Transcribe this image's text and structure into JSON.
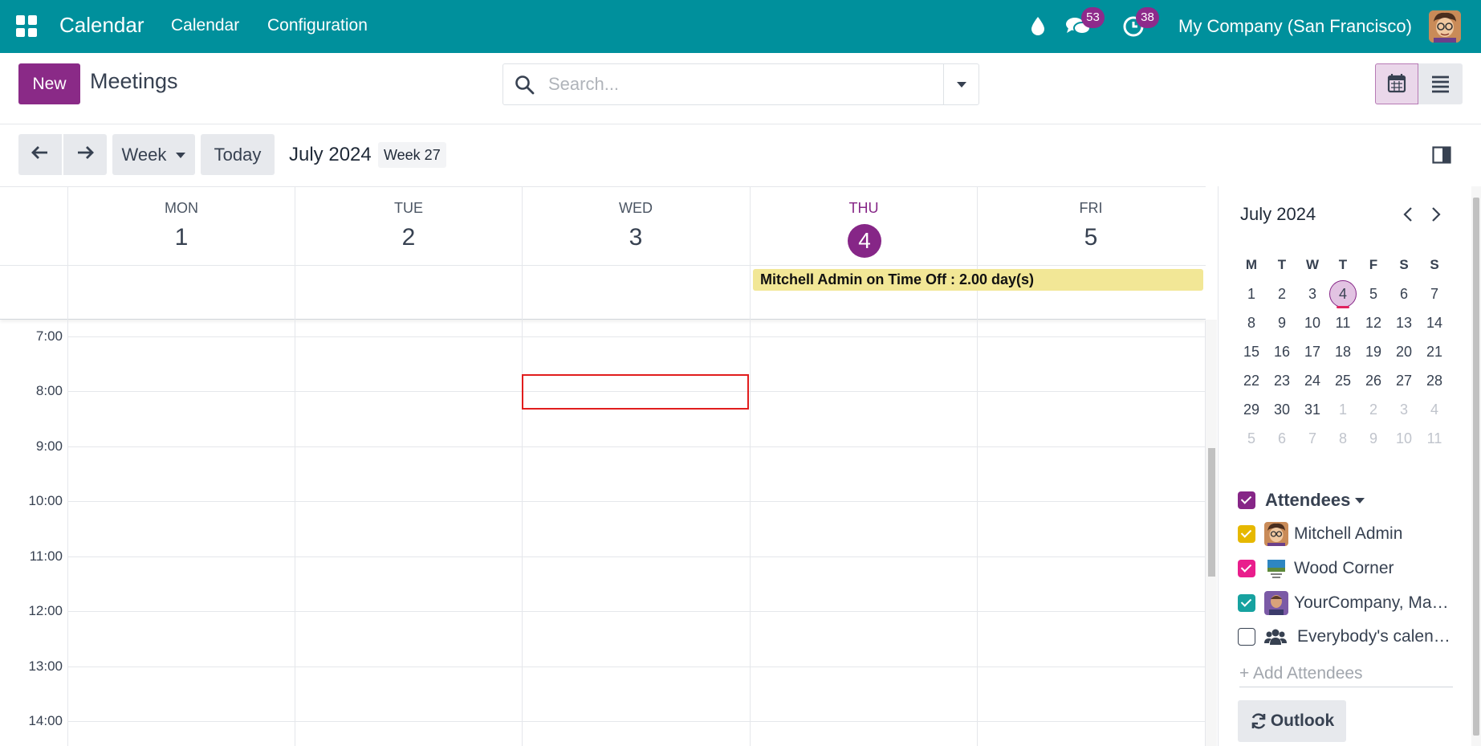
{
  "topbar": {
    "app_title": "Calendar",
    "nav": [
      "Calendar",
      "Configuration"
    ],
    "messages_count": "53",
    "activities_count": "38",
    "company": "My Company (San Francisco)",
    "colors": {
      "bar": "#00909c",
      "badge": "#8e2a8b"
    }
  },
  "control": {
    "new_label": "New",
    "title": "Meetings",
    "search_placeholder": "Search..."
  },
  "toolbar": {
    "scale_label": "Week",
    "today_label": "Today",
    "range_title": "July 2024",
    "week_label": "Week 27"
  },
  "week": {
    "days": [
      {
        "name": "MON",
        "num": "1"
      },
      {
        "name": "TUE",
        "num": "2"
      },
      {
        "name": "WED",
        "num": "3"
      },
      {
        "name": "THU",
        "num": "4",
        "today": true
      },
      {
        "name": "FRI",
        "num": "5"
      }
    ],
    "allday_event": "Mitchell Admin on Time Off : 2.00 day(s)",
    "hours": [
      "7:00",
      "8:00",
      "9:00",
      "10:00",
      "11:00",
      "12:00",
      "13:00",
      "14:00"
    ]
  },
  "mini_calendar": {
    "title": "July 2024",
    "weekdays": [
      "M",
      "T",
      "W",
      "T",
      "F",
      "S",
      "S"
    ],
    "weeks": [
      [
        "1",
        "2",
        "3",
        "4",
        "5",
        "6",
        "7"
      ],
      [
        "8",
        "9",
        "10",
        "11",
        "12",
        "13",
        "14"
      ],
      [
        "15",
        "16",
        "17",
        "18",
        "19",
        "20",
        "21"
      ],
      [
        "22",
        "23",
        "24",
        "25",
        "26",
        "27",
        "28"
      ],
      [
        "29",
        "30",
        "31",
        "1",
        "2",
        "3",
        "4"
      ],
      [
        "5",
        "6",
        "7",
        "8",
        "9",
        "10",
        "11"
      ]
    ],
    "today": "4"
  },
  "attendees": {
    "title": "Attendees",
    "items": [
      {
        "label": "Mitchell Admin",
        "color": "#e6b800",
        "checked": true
      },
      {
        "label": "Wood Corner",
        "color": "#e91e8c",
        "checked": true
      },
      {
        "label": "YourCompany, Marc Demo",
        "color": "#17a2a0",
        "checked": true
      },
      {
        "label": "Everybody's calendars",
        "color": "#ffffff",
        "checked": false
      }
    ],
    "add_placeholder": "+ Add Attendees",
    "outlook_label": "Outlook"
  }
}
